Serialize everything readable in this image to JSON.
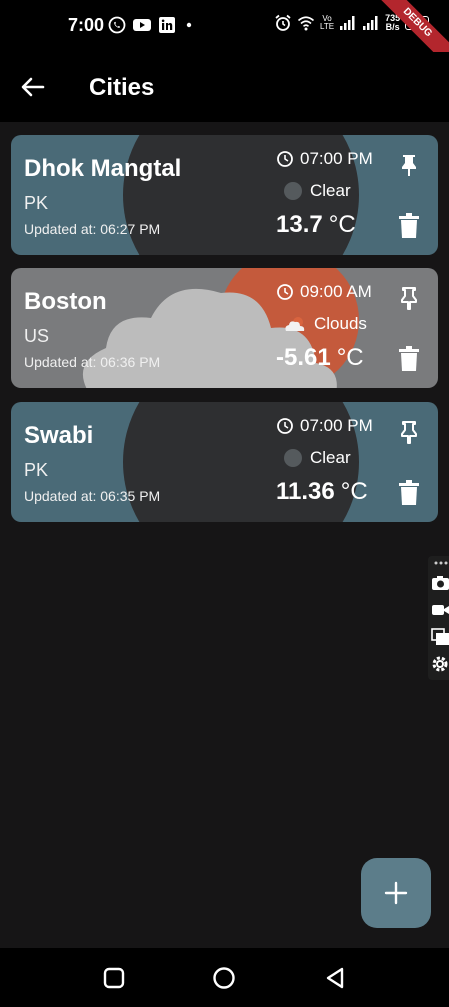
{
  "status_bar": {
    "time": "7:00",
    "net_speed_top": "735",
    "net_speed_bottom": "B/s",
    "battery": "34",
    "debug_label": "DEBUG",
    "volte_top": "Vo",
    "volte_bottom": "LTE"
  },
  "app_bar": {
    "title": "Cities"
  },
  "cities": [
    {
      "name": "Dhok Mangtal",
      "country": "PK",
      "updated": "Updated at: 06:27 PM",
      "local_time": "07:00 PM",
      "condition": "Clear",
      "temp": "13.7",
      "unit": "°C"
    },
    {
      "name": "Boston",
      "country": "US",
      "updated": "Updated at: 06:36 PM",
      "local_time": "09:00 AM",
      "condition": "Clouds",
      "temp": "-5.61",
      "unit": "°C"
    },
    {
      "name": "Swabi",
      "country": "PK",
      "updated": "Updated at: 06:35 PM",
      "local_time": "07:00 PM",
      "condition": "Clear",
      "temp": "11.36",
      "unit": "°C"
    }
  ],
  "fab": {
    "icon": "plus-icon"
  },
  "colors": {
    "card_clear": "#4a6a77",
    "card_clouds": "#7a7b7d",
    "fab": "#5c7d8a",
    "sun": "#c45a3c",
    "debug": "#b3262d"
  }
}
